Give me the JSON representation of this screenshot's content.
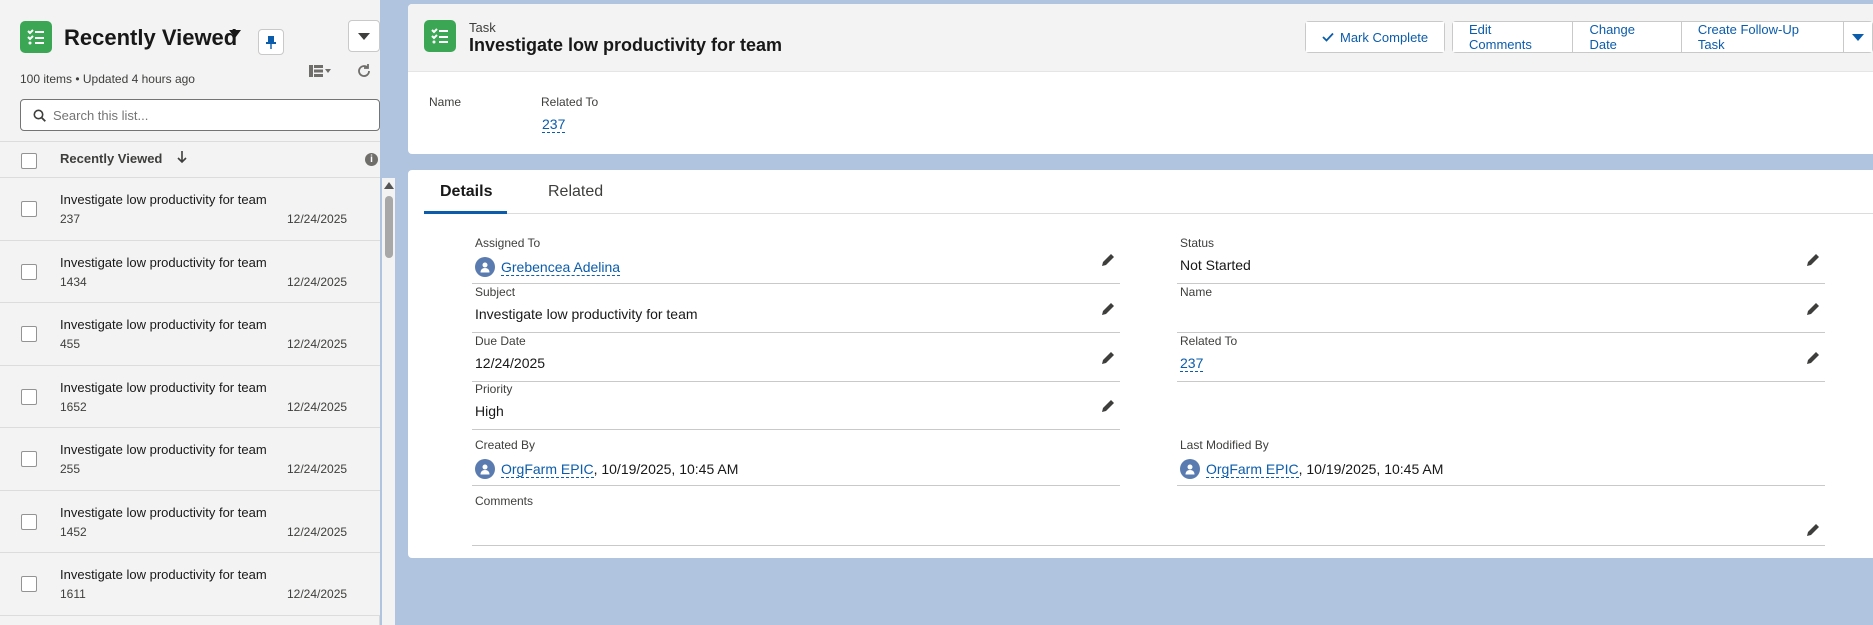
{
  "list": {
    "title": "Recently Viewed",
    "meta": "100 items • Updated 4 hours ago",
    "search_placeholder": "Search this list...",
    "column_label": "Recently Viewed",
    "rows": [
      {
        "title": "Investigate low productivity for team",
        "number": "237",
        "date": "12/24/2025"
      },
      {
        "title": "Investigate low productivity for team",
        "number": "1434",
        "date": "12/24/2025"
      },
      {
        "title": "Investigate low productivity for team",
        "number": "455",
        "date": "12/24/2025"
      },
      {
        "title": "Investigate low productivity for team",
        "number": "1652",
        "date": "12/24/2025"
      },
      {
        "title": "Investigate low productivity for team",
        "number": "255",
        "date": "12/24/2025"
      },
      {
        "title": "Investigate low productivity for team",
        "number": "1452",
        "date": "12/24/2025"
      },
      {
        "title": "Investigate low productivity for team",
        "number": "1611",
        "date": "12/24/2025"
      }
    ]
  },
  "record": {
    "type": "Task",
    "title": "Investigate low productivity for team",
    "actions": {
      "mark_complete": "Mark Complete",
      "edit_comments": "Edit Comments",
      "change_date": "Change Date",
      "create_follow_up": "Create Follow-Up Task"
    },
    "highlights": {
      "name_label": "Name",
      "related_label": "Related To",
      "related_value": "237"
    }
  },
  "tabs": {
    "details": "Details",
    "related": "Related"
  },
  "fields": {
    "assigned_to": {
      "label": "Assigned To",
      "value": "Grebencea Adelina"
    },
    "status": {
      "label": "Status",
      "value": "Not Started"
    },
    "subject": {
      "label": "Subject",
      "value": "Investigate low productivity for team"
    },
    "name": {
      "label": "Name",
      "value": ""
    },
    "due_date": {
      "label": "Due Date",
      "value": "12/24/2025"
    },
    "related_to": {
      "label": "Related To",
      "value": "237"
    },
    "priority": {
      "label": "Priority",
      "value": "High"
    },
    "created_by": {
      "label": "Created By",
      "user": "OrgFarm EPIC",
      "stamp": ", 10/19/2025, 10:45 AM"
    },
    "last_modified_by": {
      "label": "Last Modified By",
      "user": "OrgFarm EPIC",
      "stamp": ", 10/19/2025, 10:45 AM"
    },
    "comments": {
      "label": "Comments",
      "value": ""
    }
  },
  "colors": {
    "accent": "#0b5cab",
    "task_green": "#3ba755",
    "background": "#b0c4df"
  }
}
